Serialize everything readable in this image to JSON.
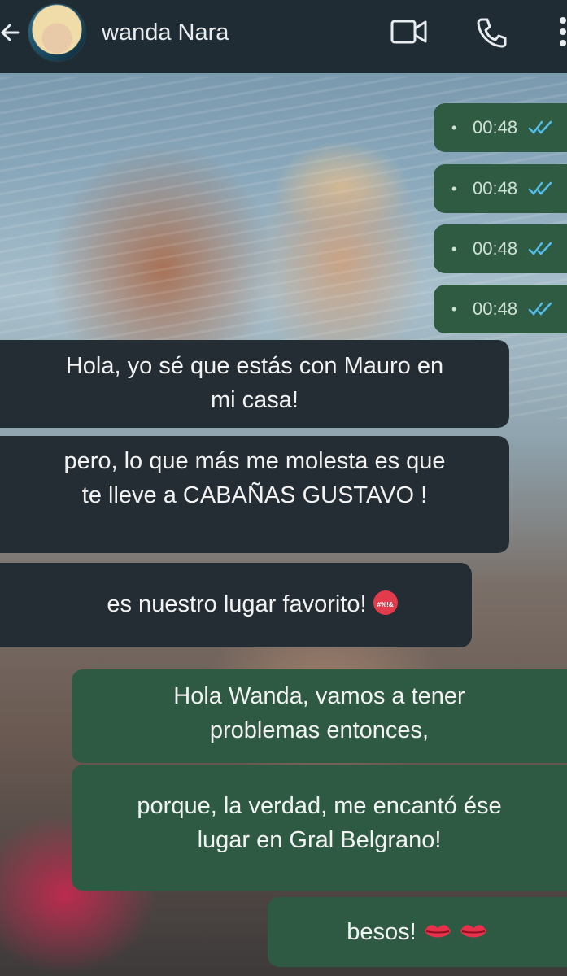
{
  "header": {
    "contact_name": "wanda Nara",
    "icons": {
      "back": "back-arrow-icon",
      "avatar": "contact-avatar",
      "video": "video-call-icon",
      "call": "phone-call-icon",
      "more": "more-options-icon"
    }
  },
  "receipts": [
    {
      "time": "00:48",
      "status_icon": "double-check-icon"
    },
    {
      "time": "00:48",
      "status_icon": "double-check-icon"
    },
    {
      "time": "00:48",
      "status_icon": "double-check-icon"
    },
    {
      "time": "00:48",
      "status_icon": "double-check-icon"
    }
  ],
  "messages": [
    {
      "direction": "incoming",
      "lines": [
        "Hola, yo sé que estás con Mauro en",
        "mi casa!"
      ]
    },
    {
      "direction": "incoming",
      "lines": [
        "pero, lo que más me molesta es que",
        "te lleve a CABAÑAS GUSTAVO !"
      ]
    },
    {
      "direction": "incoming",
      "lines": [
        "es nuestro lugar favorito!"
      ],
      "emoji": "angry-cursing-face-emoji",
      "emoji_text": "#%!&"
    },
    {
      "direction": "outgoing",
      "lines": [
        "Hola Wanda, vamos a tener",
        "problemas entonces,"
      ]
    },
    {
      "direction": "outgoing",
      "lines": [
        "porque, la verdad, me encantó ése",
        "lugar en Gral Belgrano!"
      ]
    },
    {
      "direction": "outgoing",
      "lines": [
        "besos!"
      ],
      "emoji": "kiss-mark-emoji"
    }
  ],
  "colors": {
    "header_bg": "#1f2c34",
    "incoming_bubble": "#232d33",
    "outgoing_bubble": "#2e5a44",
    "read_tick": "#53bdeb"
  }
}
